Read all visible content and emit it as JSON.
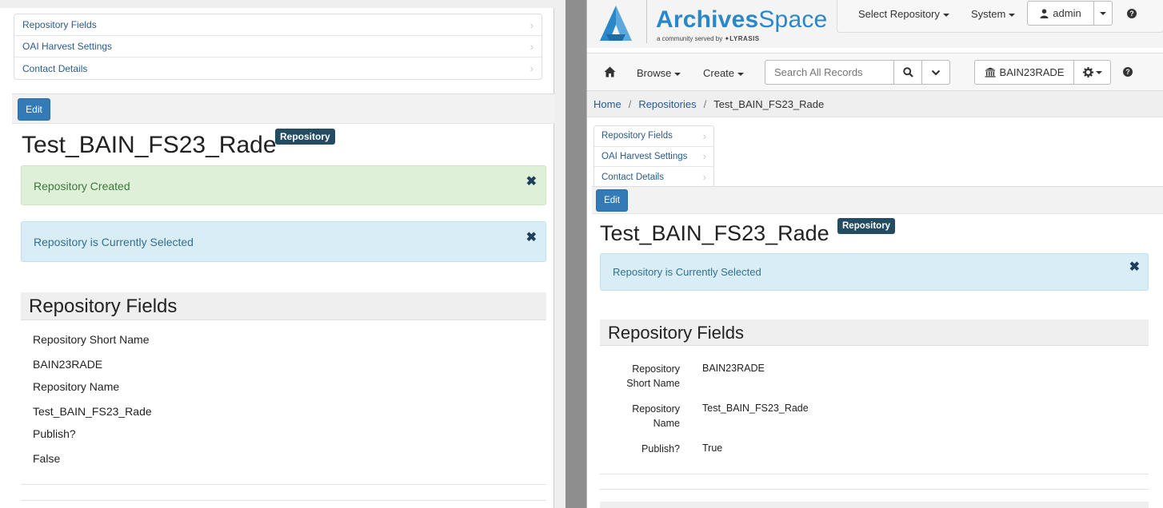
{
  "left_pane": {
    "nav": [
      "Repository Fields",
      "OAI Harvest Settings",
      "Contact Details"
    ],
    "edit_label": "Edit",
    "title": "Test_BAIN_FS23_Rade",
    "badge": "Repository",
    "alert_success": "Repository Created",
    "alert_info": "Repository is Currently Selected",
    "close_glyph": "✖",
    "section_title": "Repository Fields",
    "fields": [
      {
        "label": "Repository Short Name",
        "value": "BAIN23RADE"
      },
      {
        "label": "Repository Name",
        "value": "Test_BAIN_FS23_Rade"
      },
      {
        "label": "Publish?",
        "value": "False"
      }
    ]
  },
  "right_pane": {
    "brand": {
      "name_bold": "Archives",
      "name_light": "Space",
      "tagline_prefix": "a community served by",
      "tagline_org": "LYRASIS"
    },
    "topbar": {
      "select_repository": "Select Repository",
      "system": "System",
      "user": "admin"
    },
    "nav": {
      "browse": "Browse",
      "create": "Create",
      "search_placeholder": "Search All Records",
      "current_repo": "BAIN23RADE"
    },
    "breadcrumb": [
      "Home",
      "Repositories",
      "Test_BAIN_FS23_Rade"
    ],
    "side_nav": [
      "Repository Fields",
      "OAI Harvest Settings",
      "Contact Details"
    ],
    "edit_label": "Edit",
    "title": "Test_BAIN_FS23_Rade",
    "badge": "Repository",
    "alert_info": "Repository is Currently Selected",
    "close_glyph": "✖",
    "section_title": "Repository Fields",
    "fields": [
      {
        "label_line1": "Repository",
        "label_line2": "Short Name",
        "value": "BAIN23RADE"
      },
      {
        "label_line1": "Repository",
        "label_line2": "Name",
        "value": "Test_BAIN_FS23_Rade"
      },
      {
        "label_line1": "Publish?",
        "label_line2": "",
        "value": "True"
      }
    ]
  },
  "colors": {
    "primary": "#337ab7",
    "badge": "#234b62",
    "link": "#2a5b8a",
    "success_bg": "#dff0d8",
    "info_bg": "#d9edf7",
    "logo": "#2a87c8"
  }
}
